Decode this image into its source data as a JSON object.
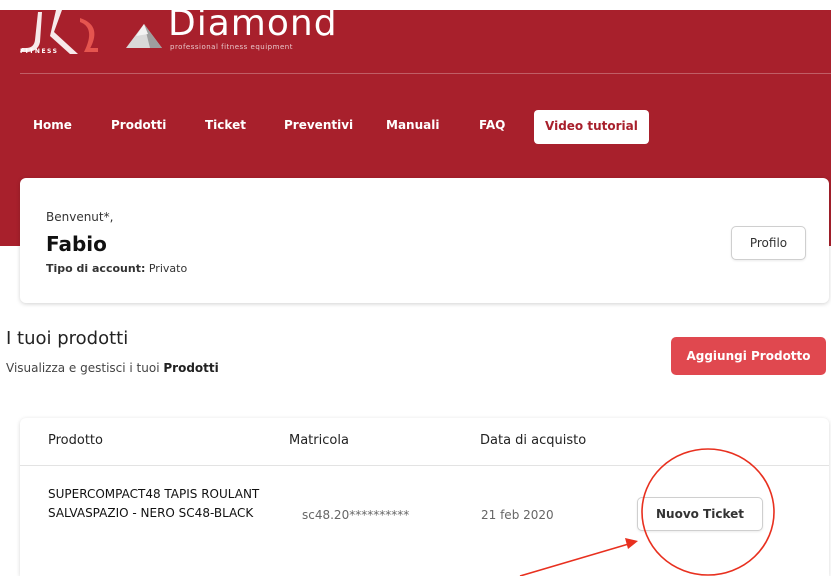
{
  "brand": {
    "jk_subtitle": "FITNESS",
    "diamond_name": "Diamond",
    "diamond_tagline": "professional fitness equipment"
  },
  "nav": {
    "items": [
      {
        "label": "Home"
      },
      {
        "label": "Prodotti"
      },
      {
        "label": "Ticket"
      },
      {
        "label": "Preventivi"
      },
      {
        "label": "Manuali"
      },
      {
        "label": "FAQ"
      },
      {
        "label": "Video tutorial"
      }
    ]
  },
  "profile_card": {
    "welcome": "Benvenut*,",
    "name": "Fabio",
    "account_type_label": "Tipo di account:",
    "account_type_value": "Privato",
    "profile_button": "Profilo"
  },
  "products_section": {
    "title": "I tuoi prodotti",
    "subtitle_prefix": "Visualizza e gestisci i tuoi",
    "subtitle_bold": "Prodotti",
    "add_button": "Aggiungi Prodotto"
  },
  "table": {
    "columns": [
      "Prodotto",
      "Matricola",
      "Data di acquisto"
    ],
    "rows": [
      {
        "product": "SUPERCOMPACT48 TAPIS ROULANT SALVASPAZIO - NERO SC48-BLACK",
        "serial": "sc48.20**********",
        "purchase_date": "21 feb 2020",
        "action": "Nuovo Ticket"
      }
    ]
  },
  "colors": {
    "header_red": "#a8202c",
    "accent_button": "#e0484f",
    "annotation_red": "#e8301f"
  }
}
